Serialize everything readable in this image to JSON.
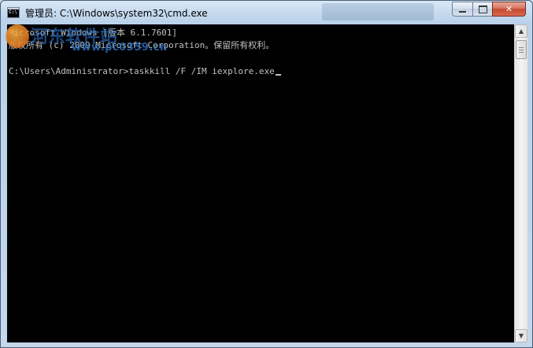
{
  "window": {
    "title": "管理员: C:\\Windows\\system32\\cmd.exe",
    "icon": "cmd-icon",
    "controls": {
      "minimize": "minimize-icon",
      "maximize": "maximize-icon",
      "close_label": "✕"
    }
  },
  "console": {
    "lines": [
      "Microsoft Windows [版本 6.1.7601]",
      "版权所有 (c) 2009 Microsoft Corporation。保留所有权利。",
      "C:\\Users\\Administrator>taskkill /F /IM iexplore.exe"
    ],
    "text_color": "#c0c0c0",
    "background_color": "#000000"
  },
  "watermark": {
    "text_cn": "河东软件站",
    "url": "www.pc0359.cn"
  },
  "scrollbar": {
    "up_arrow": "▲",
    "down_arrow": "▼"
  }
}
